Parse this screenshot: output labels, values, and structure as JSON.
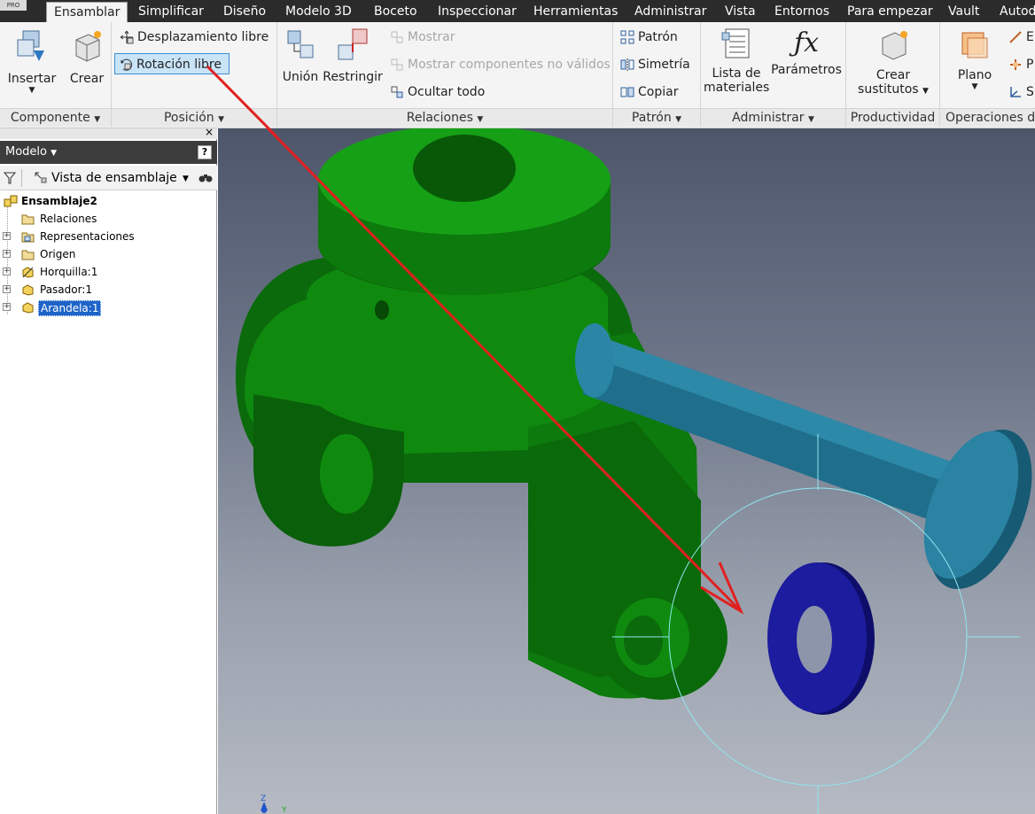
{
  "app": {
    "edition_badge": "PRO"
  },
  "menu": {
    "tabs": [
      {
        "label": "Ensamblar",
        "active": true
      },
      {
        "label": "Simplificar"
      },
      {
        "label": "Diseño"
      },
      {
        "label": "Modelo 3D"
      },
      {
        "label": "Boceto"
      },
      {
        "label": "Inspeccionar"
      },
      {
        "label": "Herramientas"
      },
      {
        "label": "Administrar"
      },
      {
        "label": "Vista"
      },
      {
        "label": "Entornos"
      },
      {
        "label": "Para empezar"
      },
      {
        "label": "Vault"
      },
      {
        "label": "Autod"
      }
    ]
  },
  "ribbon": {
    "componente": {
      "label": "Componente",
      "insertar": "Insertar",
      "crear": "Crear"
    },
    "posicion": {
      "label": "Posición",
      "desplazamiento": "Desplazamiento libre",
      "rotacion": "Rotación libre"
    },
    "relaciones": {
      "label": "Relaciones",
      "union": "Unión",
      "restringir": "Restringir",
      "mostrar": "Mostrar",
      "mostrar_no_validos": "Mostrar componentes no válidos",
      "ocultar_todo": "Ocultar todo"
    },
    "patron": {
      "label": "Patrón",
      "patron": "Patrón",
      "simetria": "Simetría",
      "copiar": "Copiar"
    },
    "administrar": {
      "label": "Administrar",
      "lista_line1": "Lista de",
      "lista_line2": "materiales",
      "parametros": "Parámetros"
    },
    "productividad": {
      "label": "Productividad",
      "crear_line1": "Crear",
      "crear_line2": "sustitutos"
    },
    "operaciones": {
      "label": "Operaciones de",
      "plano": "Plano",
      "cut_e": "E",
      "cut_p": "P",
      "cut_s": "S"
    }
  },
  "browser": {
    "title": "Modelo",
    "help": "?",
    "close": "×",
    "view_label": "Vista de ensamblaje",
    "tree": [
      {
        "label": "Ensamblaje2",
        "bold": true,
        "icon": "assembly-icon",
        "expander": false,
        "depth": 0
      },
      {
        "label": "Relaciones",
        "icon": "folder-icon",
        "expander": false,
        "depth": 1
      },
      {
        "label": "Representaciones",
        "icon": "representations-icon",
        "expander": true,
        "depth": 1
      },
      {
        "label": "Origen",
        "icon": "folder-icon",
        "expander": true,
        "depth": 1
      },
      {
        "label": "Horquilla:1",
        "icon": "grounded-part-icon",
        "expander": true,
        "depth": 1
      },
      {
        "label": "Pasador:1",
        "icon": "part-icon",
        "expander": true,
        "depth": 1
      },
      {
        "label": "Arandela:1",
        "icon": "part-icon",
        "expander": true,
        "depth": 1,
        "selected": true
      }
    ]
  },
  "viewport": {
    "axis_z": "Z",
    "axis_y": "Y"
  },
  "colors": {
    "fork": "#0e7a0e",
    "pin": "#1f6e8c",
    "washer": "#1a1a8c",
    "arrow": "#e02020",
    "rotate_gizmo": "#8fe8ef",
    "selection": "#1e64c8"
  }
}
